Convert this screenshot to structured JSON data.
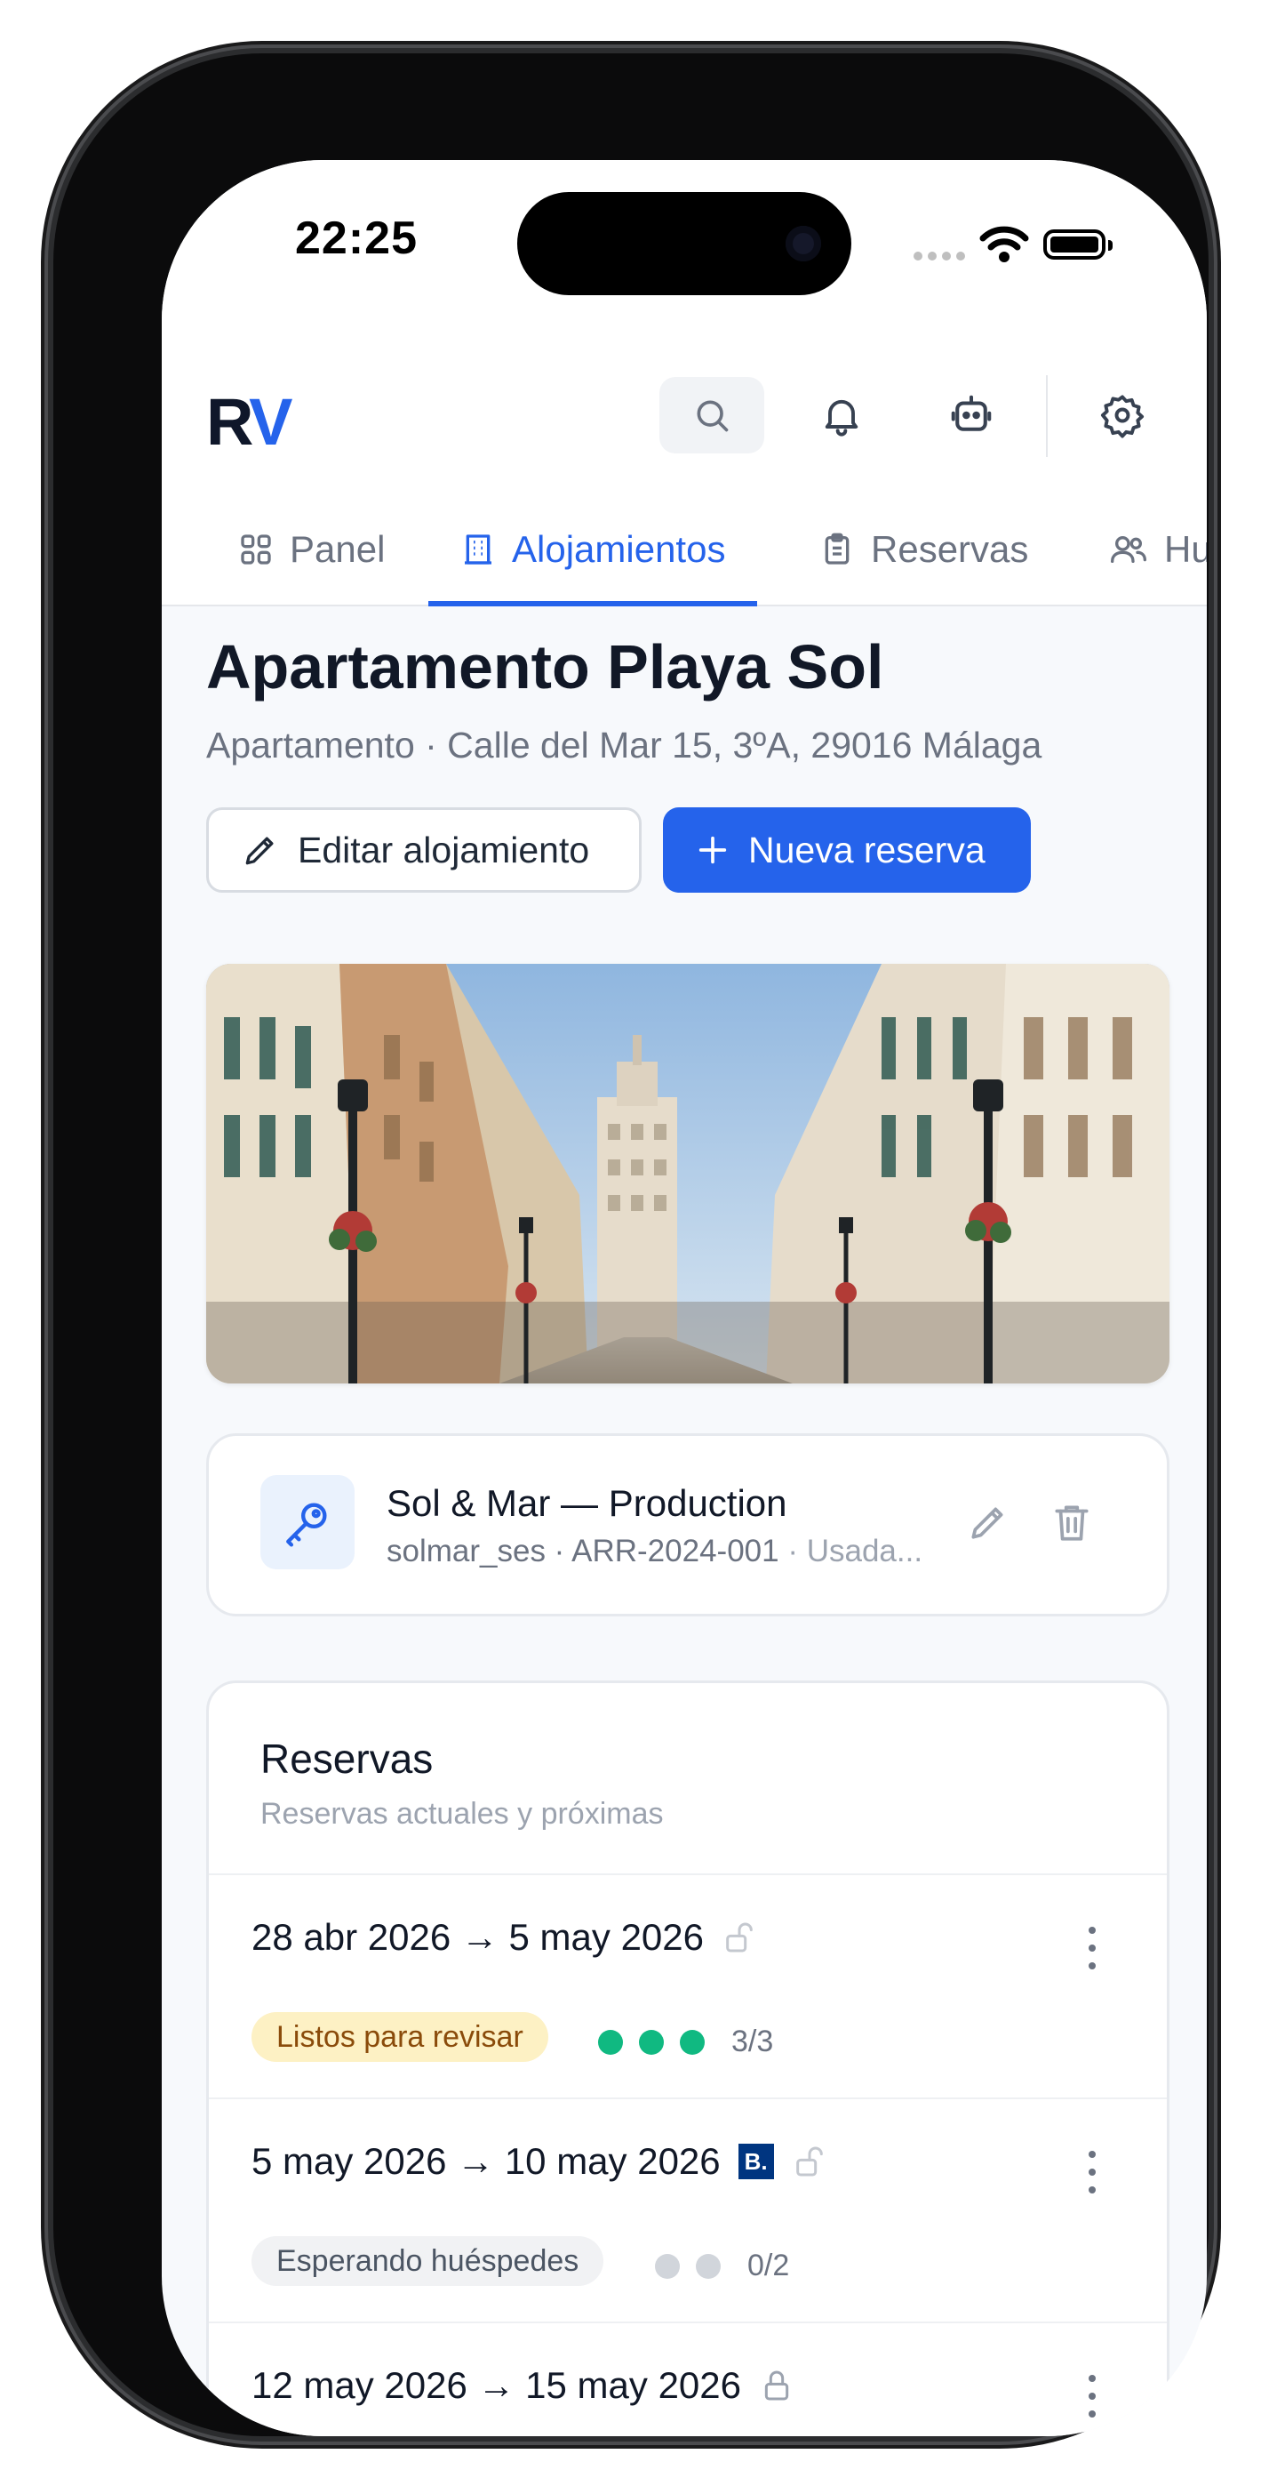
{
  "status_bar": {
    "time": "22:25"
  },
  "header": {
    "logo_r": "R",
    "logo_v": "V"
  },
  "tabs": [
    {
      "label": "Panel",
      "icon": "grid-icon",
      "active": false
    },
    {
      "label": "Alojamientos",
      "icon": "building-icon",
      "active": true
    },
    {
      "label": "Reservas",
      "icon": "clipboard-icon",
      "active": false
    },
    {
      "label": "Hu",
      "icon": "users-icon",
      "active": false
    }
  ],
  "property": {
    "title": "Apartamento Playa Sol",
    "subtitle": "Apartamento · Calle del Mar 15, 3ºA, 29016 Málaga",
    "edit_label": "Editar alojamiento",
    "new_booking_label": "Nueva reserva"
  },
  "credential": {
    "name": "Sol & Mar — Production",
    "meta": "solmar_ses · ARR-2024-001",
    "meta_extra": " · Usada..."
  },
  "reservations": {
    "title": "Reservas",
    "subtitle": "Reservas actuales y próximas",
    "items": [
      {
        "dates": "28 abr 2026 → 5 may 2026",
        "booking": false,
        "lock": "unlocked",
        "status": "Listos para revisar",
        "status_tone": "amber",
        "guests_done": 3,
        "guests_total": 3,
        "count": "3/3"
      },
      {
        "dates": "5 may 2026 → 10 may 2026",
        "booking": true,
        "booking_label": "B.",
        "lock": "unlocked",
        "status": "Esperando huéspedes",
        "status_tone": "gray",
        "guests_done": 0,
        "guests_total": 2,
        "count": "0/2"
      },
      {
        "dates": "12 may 2026 → 15 may 2026",
        "booking": false,
        "lock": "locked"
      }
    ]
  },
  "colors": {
    "accent": "#2563eb",
    "success": "#10b981",
    "pending": "#d1d5db",
    "title": "#111827"
  }
}
